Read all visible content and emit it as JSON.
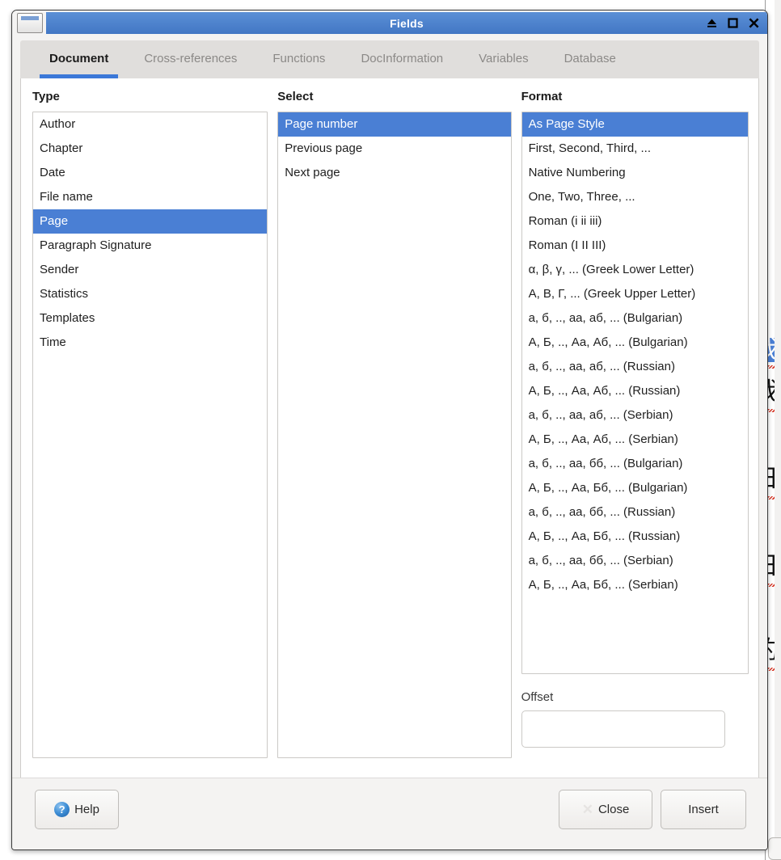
{
  "window": {
    "title": "Fields",
    "icon": "window-icon",
    "buttons": [
      {
        "name": "shade-button",
        "glyph": "eject"
      },
      {
        "name": "maximize-button",
        "glyph": "square"
      },
      {
        "name": "close-button",
        "glyph": "x"
      }
    ]
  },
  "tabs": [
    {
      "label": "Document",
      "active": true
    },
    {
      "label": "Cross-references",
      "active": false
    },
    {
      "label": "Functions",
      "active": false
    },
    {
      "label": "DocInformation",
      "active": false
    },
    {
      "label": "Variables",
      "active": false
    },
    {
      "label": "Database",
      "active": false
    }
  ],
  "type": {
    "label": "Type",
    "items": [
      "Author",
      "Chapter",
      "Date",
      "File name",
      "Page",
      "Paragraph Signature",
      "Sender",
      "Statistics",
      "Templates",
      "Time"
    ],
    "selected": "Page"
  },
  "select": {
    "label": "Select",
    "items": [
      "Page number",
      "Previous page",
      "Next page"
    ],
    "selected": "Page number"
  },
  "format": {
    "label": "Format",
    "items": [
      "As Page Style",
      "First, Second, Third, ...",
      "Native Numbering",
      "One, Two, Three, ...",
      "Roman (i ii iii)",
      "Roman (I II III)",
      "α, β, γ, ... (Greek Lower Letter)",
      "Α, Β, Γ, ... (Greek Upper Letter)",
      "а, б, .., аа, аб, ... (Bulgarian)",
      "А, Б, .., Аа, Аб, ... (Bulgarian)",
      "а, б, .., аа, аб, ... (Russian)",
      "А, Б, .., Аа, Аб, ... (Russian)",
      "а, б, .., аа, аб, ... (Serbian)",
      "А, Б, .., Аа, Аб, ... (Serbian)",
      "а, б, .., аа, бб, ... (Bulgarian)",
      "А, Б, .., Аа, Бб, ... (Bulgarian)",
      "а, б, .., аа, бб, ... (Russian)",
      "А, Б, .., Аа, Бб, ... (Russian)",
      "а, б, .., аа, бб, ... (Serbian)",
      "А, Б, .., Аа, Бб, ... (Serbian)"
    ],
    "selected": "As Page Style"
  },
  "offset": {
    "label": "Offset",
    "value": "",
    "placeholder": ""
  },
  "buttons": {
    "help": "Help",
    "close": "Close",
    "insert": "Insert"
  },
  "colors": {
    "selection": "#4a7fd4",
    "tab_accent": "#3b78d8",
    "titlebar": "#4277c4",
    "dialog_bg": "#f4f3f2"
  },
  "background_document": {
    "glyphs": [
      "我",
      "日",
      "日",
      "约"
    ],
    "spellcheck_underline": true
  }
}
